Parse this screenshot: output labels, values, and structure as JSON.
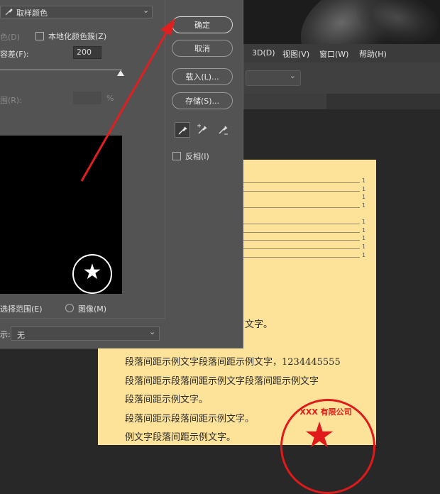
{
  "app": {
    "menubar": [
      "3D(D)",
      "视图(V)",
      "窗口(W)",
      "帮助(H)"
    ]
  },
  "dialog": {
    "select_label": "取样颜色",
    "left_checkbox_label": "色(D)",
    "localized_label": "本地化颜色簇(Z)",
    "tolerance_label": "容差(F):",
    "tolerance_value": "200",
    "range_label": "围(R):",
    "range_unit": "%",
    "selection_radio_label": "选择范围(E)",
    "image_radio_label": "图像(M)",
    "matte_label": "示:",
    "matte_value": "无",
    "buttons": {
      "ok": "确定",
      "cancel": "取消",
      "load": "载入(L)...",
      "save": "存储(S)..."
    },
    "invert_label": "反相(I)",
    "tolerance_slider": 1.0
  },
  "document": {
    "toc_numbers": [
      "1",
      "1",
      "1",
      "1",
      "1",
      "1",
      "1",
      "1",
      "1"
    ],
    "lines": [
      "文字。",
      "段落间距示例文字段落间距示例文字，1234445555",
      "段落间距示段落间距示例文字段落间距示例文字",
      "段落间距示例文字。",
      "段落间距示段落间距示例文字。",
      "例文字段落间距示例文字。"
    ],
    "stamp_text": "XXX 有限公司"
  },
  "colors": {
    "dialog_bg": "#535353",
    "doc_bg": "#fde39a",
    "stamp": "#e01a1a",
    "arrow": "#e02020"
  }
}
